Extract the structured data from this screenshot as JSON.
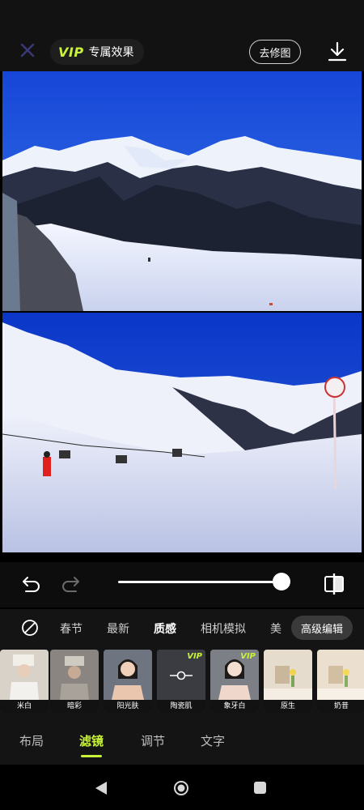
{
  "top_bar": {
    "vip_tag": "VIP",
    "vip_label": "专属效果",
    "watermark_button": "去修图",
    "icons": {
      "close": "close-icon",
      "download": "download-icon"
    }
  },
  "photos": [
    {
      "name": "photo-top",
      "description_icon": "landscape-photo"
    },
    {
      "name": "photo-bottom",
      "description_icon": "landscape-photo"
    }
  ],
  "controls": {
    "intensity": 100,
    "icons": {
      "undo": "undo-icon",
      "redo": "redo-icon",
      "compare": "compare-icon"
    }
  },
  "filter_tabs": {
    "items": [
      "春节",
      "最新",
      "质感",
      "相机模拟",
      "美"
    ],
    "active": "质感",
    "advanced_button": "高级编辑"
  },
  "filters": [
    {
      "label": "米白",
      "vip": false
    },
    {
      "label": "暗彩",
      "vip": false
    },
    {
      "label": "阳光肤",
      "vip": false
    },
    {
      "label": "陶瓷肌",
      "vip": true,
      "vip_tag": "VIP"
    },
    {
      "label": "象牙白",
      "vip": true,
      "vip_tag": "VIP"
    },
    {
      "label": "原生",
      "vip": false
    },
    {
      "label": "奶昔",
      "vip": false
    }
  ],
  "bottom_tabs": {
    "items": [
      "布局",
      "滤镜",
      "调节",
      "文字"
    ],
    "active": "滤镜"
  },
  "colors": {
    "accent": "#c9f23a",
    "background": "#141414",
    "sky": "#1b4fd6"
  }
}
